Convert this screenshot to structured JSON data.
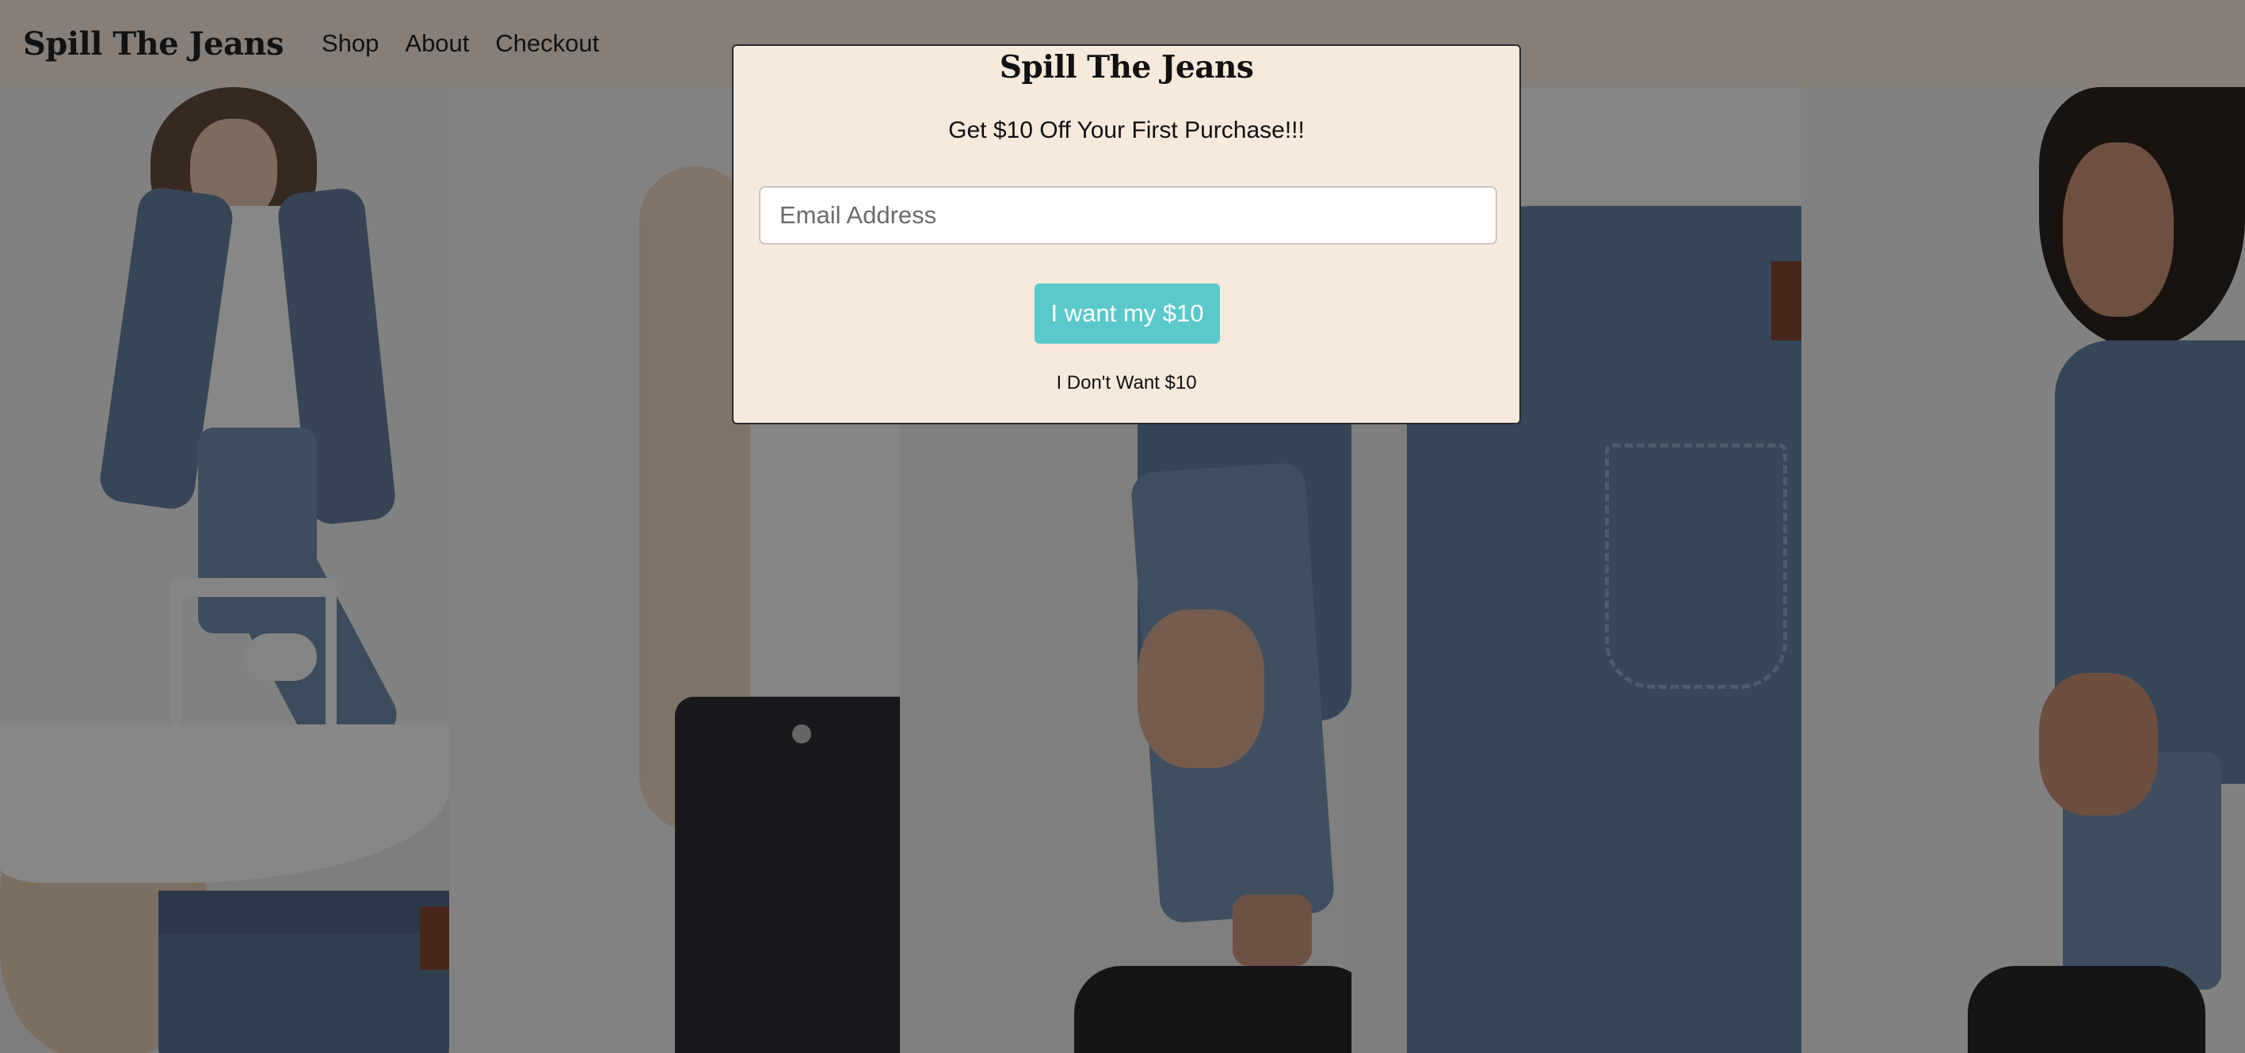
{
  "navbar": {
    "brand": "Spill The Jeans",
    "links": [
      "Shop",
      "About",
      "Checkout"
    ]
  },
  "modal": {
    "title": "Spill The Jeans",
    "subtitle": "Get $10 Off Your First Purchase!!!",
    "email_placeholder": "Email Address",
    "cta_label": "I want my $10",
    "decline_label": "I Don't Want $10"
  },
  "colors": {
    "cream_background": "#f8e9dd",
    "cta_teal": "#5bc9cc",
    "overlay": "rgba(20,20,20,0.5)"
  }
}
